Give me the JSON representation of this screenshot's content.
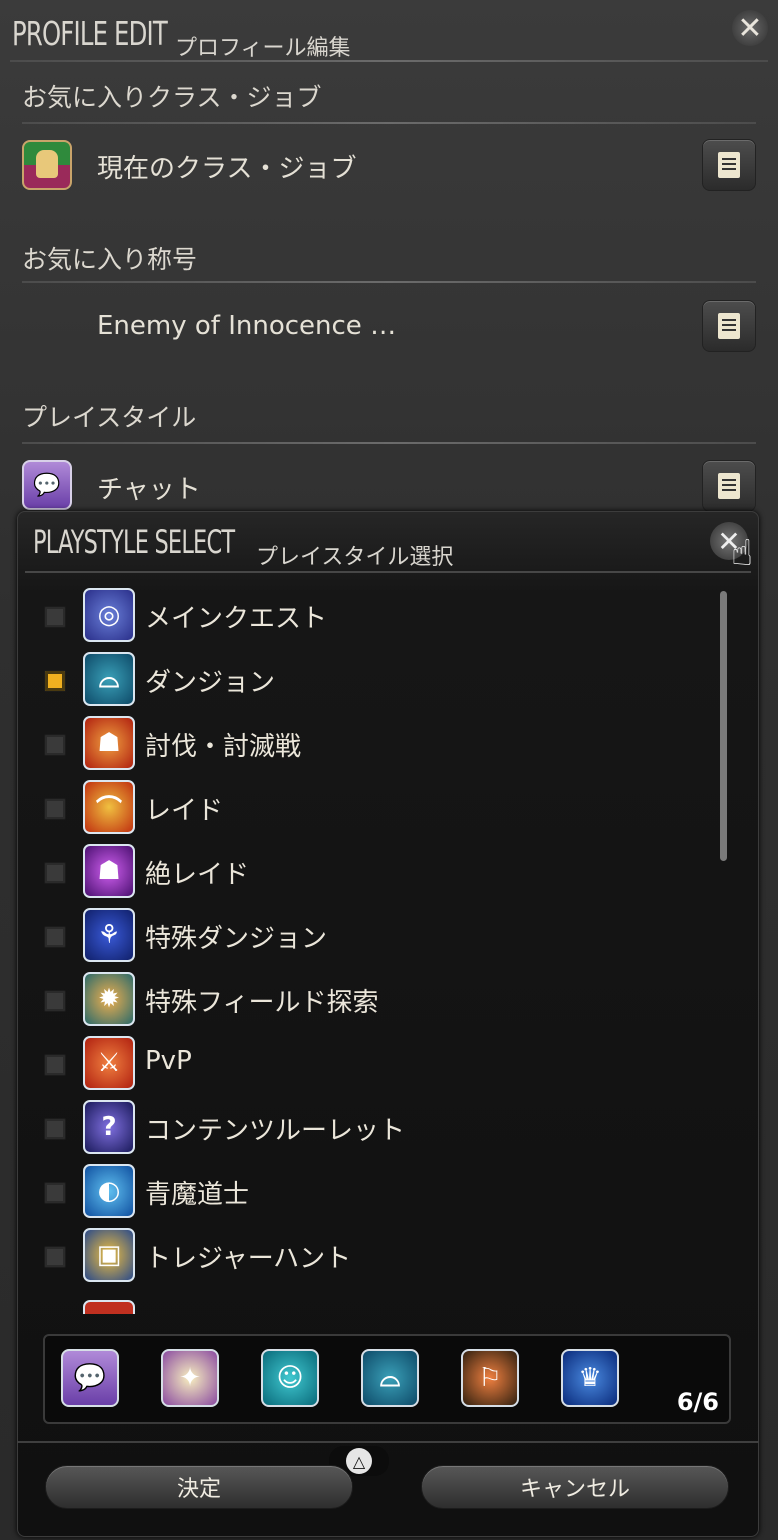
{
  "profile": {
    "title_en": "PROFILE EDIT",
    "title_ja": "プロフィール編集",
    "sections": [
      {
        "label": "お気に入りクラス・ジョブ",
        "value": "現在のクラス・ジョブ"
      },
      {
        "label": "お気に入り称号",
        "value": "Enemy of Innocence …"
      },
      {
        "label": "プレイスタイル",
        "value": "チャット"
      }
    ]
  },
  "playstyle": {
    "title_en": "PLAYSTYLE SELECT",
    "title_ja": "プレイスタイル選択",
    "items": [
      {
        "label": "メインクエスト",
        "checked": false,
        "icon": "main-quest-icon"
      },
      {
        "label": "ダンジョン",
        "checked": true,
        "icon": "dungeon-icon"
      },
      {
        "label": "討伐・討滅戦",
        "checked": false,
        "icon": "trial-icon"
      },
      {
        "label": "レイド",
        "checked": false,
        "icon": "raid-icon"
      },
      {
        "label": "絶レイド",
        "checked": false,
        "icon": "ultimate-raid-icon"
      },
      {
        "label": "特殊ダンジョン",
        "checked": false,
        "icon": "deep-dungeon-icon"
      },
      {
        "label": "特殊フィールド探索",
        "checked": false,
        "icon": "field-exploration-icon"
      },
      {
        "label": "PvP",
        "checked": false,
        "icon": "pvp-icon"
      },
      {
        "label": "コンテンツルーレット",
        "checked": false,
        "icon": "roulette-icon"
      },
      {
        "label": "青魔道士",
        "checked": false,
        "icon": "blue-mage-icon"
      },
      {
        "label": "トレジャーハント",
        "checked": false,
        "icon": "treasure-hunt-icon"
      }
    ],
    "selected_count": "6/6",
    "selected_icons": [
      "chat-icon",
      "glamour-icon",
      "smile-icon",
      "dungeon-icon",
      "group-pose-icon",
      "crown-icon"
    ],
    "confirm_label": "決定",
    "cancel_label": "キャンセル"
  },
  "colors": {
    "accent_check": "#f0b020",
    "panel_bg": "#101010"
  }
}
